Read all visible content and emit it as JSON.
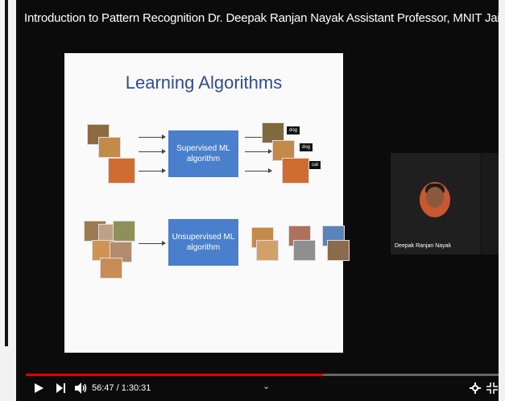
{
  "video": {
    "title": "Introduction to Pattern Recognition Dr. Deepak Ranjan Nayak Assistant Professor, MNIT Jaipur",
    "progress_fraction": 0.6287
  },
  "slide": {
    "heading": "Learning Algorithms",
    "supervised_label": "Supervised ML algorithm",
    "unsupervised_label": "Unsupervised ML algorithm",
    "labels": [
      "dog",
      "dog",
      "cat"
    ]
  },
  "presenter": {
    "name": "Deepak Ranjan Nayak"
  },
  "controls": {
    "time": "56:47 / 1:30:31",
    "play_icon": "play-icon",
    "next_icon": "next-icon",
    "volume_icon": "volume-icon",
    "settings_icon": "gear-icon",
    "fullscreen_icon": "exit-fullscreen-icon"
  },
  "colors": {
    "accent": "#e10000",
    "slide_heading": "#2f4d8e",
    "algo_box": "#4a7fcb"
  }
}
